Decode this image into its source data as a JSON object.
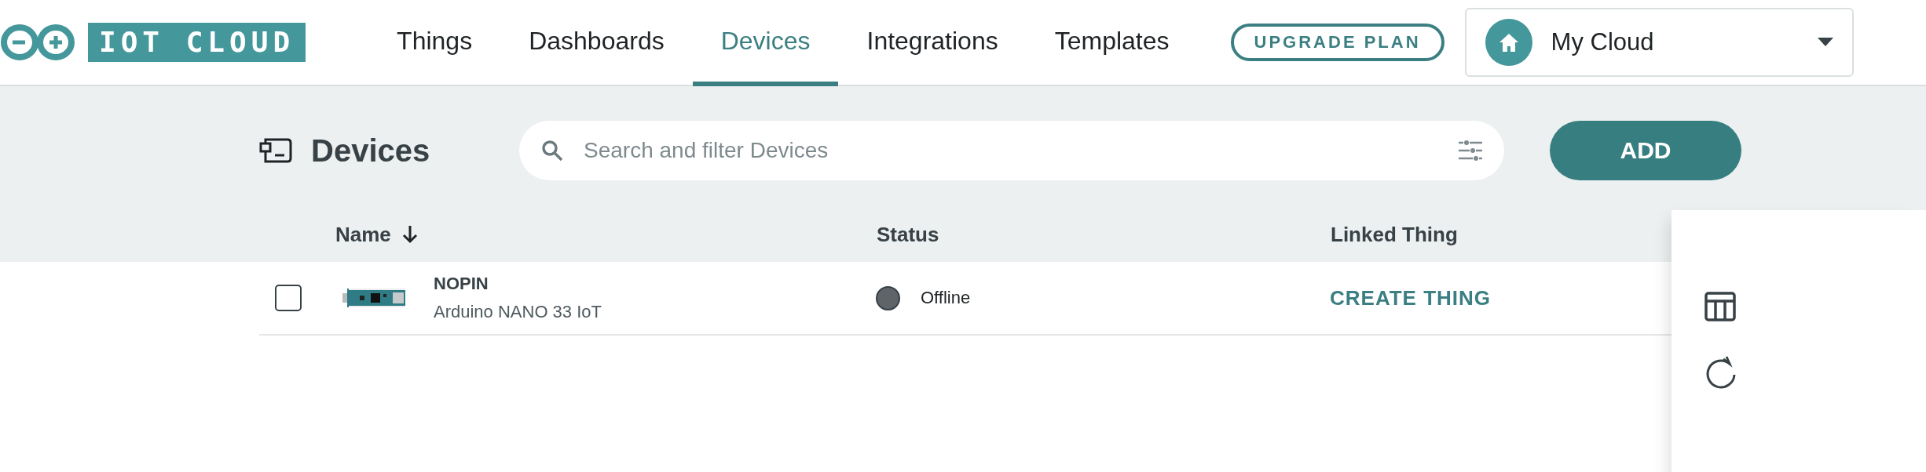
{
  "header": {
    "logo_text": "IOT CLOUD",
    "nav": [
      {
        "label": "Things",
        "selected": false
      },
      {
        "label": "Dashboards",
        "selected": false
      },
      {
        "label": "Devices",
        "selected": true
      },
      {
        "label": "Integrations",
        "selected": false
      },
      {
        "label": "Templates",
        "selected": false
      }
    ],
    "upgrade_button": "UPGRADE PLAN",
    "space_selector": "My Cloud"
  },
  "toolbar": {
    "title": "Devices",
    "search": {
      "placeholder": "Search and filter Devices"
    },
    "add_button": "ADD"
  },
  "table": {
    "columns": [
      "Name",
      "Status",
      "Linked Thing"
    ],
    "rows": [
      {
        "checked": false,
        "name": "NOPIN",
        "board": "Arduino NANO 33 IoT",
        "status": "Offline",
        "linked_thing": "CREATE THING"
      }
    ]
  }
}
